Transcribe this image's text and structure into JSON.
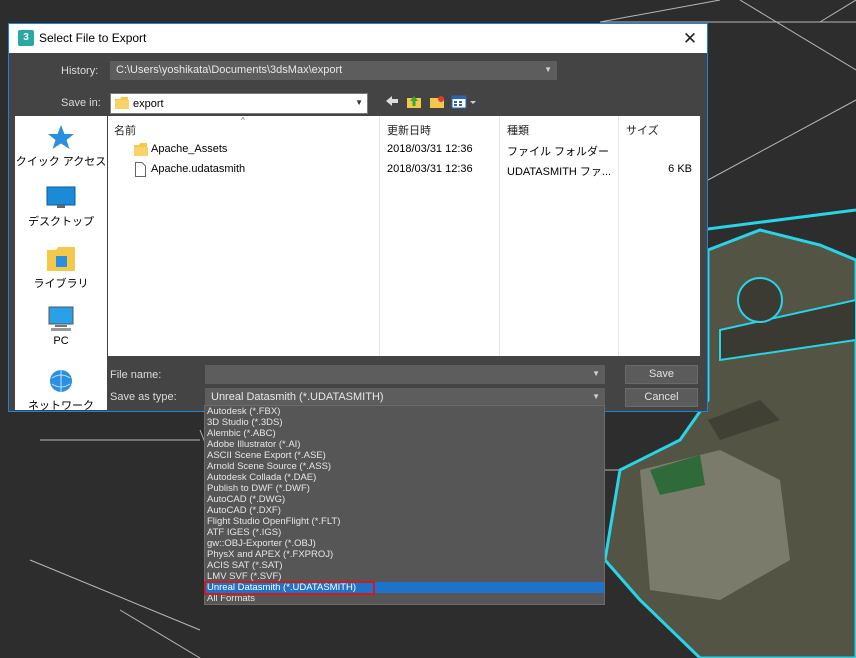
{
  "dialog": {
    "title": "Select File to Export",
    "app_icon_text": "3",
    "close_glyph": "✕"
  },
  "history": {
    "label": "History:",
    "value": "C:\\Users\\yoshikata\\Documents\\3dsMax\\export"
  },
  "save_in": {
    "label": "Save in:",
    "value": "export"
  },
  "toolbar": {
    "icons": [
      "back-icon",
      "up-folder-icon",
      "new-folder-icon",
      "view-menu-icon"
    ]
  },
  "places": [
    {
      "label": "クイック アクセス",
      "icon": "quick-access-star-icon"
    },
    {
      "label": "デスクトップ",
      "icon": "desktop-icon"
    },
    {
      "label": "ライブラリ",
      "icon": "library-icon"
    },
    {
      "label": "PC",
      "icon": "pc-icon"
    },
    {
      "label": "ネットワーク",
      "icon": "network-icon"
    }
  ],
  "file_list": {
    "columns": [
      "名前",
      "更新日時",
      "種類",
      "サイズ"
    ],
    "rows": [
      {
        "name": "Apache_Assets",
        "date": "2018/03/31 12:36",
        "type": "ファイル フォルダー",
        "size": "",
        "icon": "folder-icon"
      },
      {
        "name": "Apache.udatasmith",
        "date": "2018/03/31 12:36",
        "type": "UDATASMITH ファ...",
        "size": "6 KB",
        "icon": "file-icon"
      }
    ]
  },
  "file_name": {
    "label": "File name:",
    "value": ""
  },
  "save_as_type": {
    "label": "Save as type:",
    "value": "Unreal Datasmith (*.UDATASMITH)",
    "options": [
      "Autodesk (*.FBX)",
      "3D Studio (*.3DS)",
      "Alembic (*.ABC)",
      "Adobe Illustrator (*.AI)",
      "ASCII Scene Export (*.ASE)",
      "Arnold Scene Source (*.ASS)",
      "Autodesk Collada (*.DAE)",
      "Publish to DWF (*.DWF)",
      "AutoCAD (*.DWG)",
      "AutoCAD (*.DXF)",
      "Flight Studio OpenFlight (*.FLT)",
      "ATF IGES (*.IGS)",
      "gw::OBJ-Exporter (*.OBJ)",
      "PhysX and APEX (*.FXPROJ)",
      "ACIS SAT (*.SAT)",
      "LMV SVF (*.SVF)",
      "Unreal Datasmith (*.UDATASMITH)",
      "All Formats"
    ],
    "selected_index": 16
  },
  "buttons": {
    "save": "Save",
    "cancel": "Cancel"
  },
  "colors": {
    "dialog_bg": "#444444",
    "accent_border": "#1a84d8",
    "selection": "#1d73c9",
    "highlight_outline": "#d31919",
    "viewport_outline": "#27d4e8"
  }
}
